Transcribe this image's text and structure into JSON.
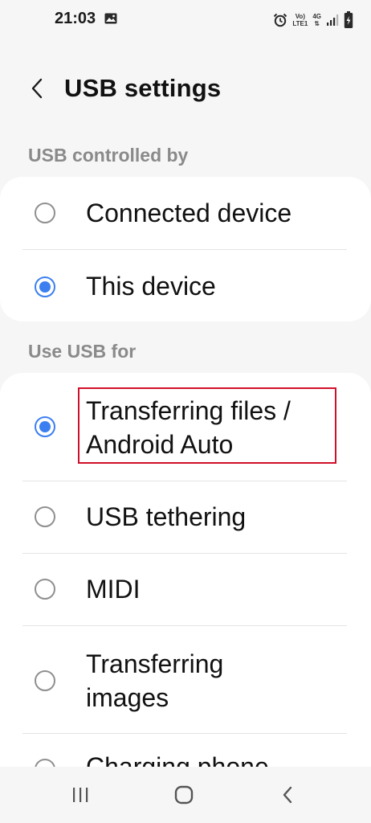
{
  "status_bar": {
    "time": "21:03",
    "network_top": "Vo)",
    "network_bottom": "LTE1",
    "signal_type": "4G",
    "icons": [
      "gallery-icon",
      "alarm-icon",
      "signal-icon",
      "battery-icon"
    ]
  },
  "header": {
    "back_icon": "chevron-left-icon",
    "title": "USB settings"
  },
  "usb_controlled_by": {
    "section_label": "USB controlled by",
    "options": [
      {
        "label": "Connected device",
        "selected": false
      },
      {
        "label": "This device",
        "selected": true
      }
    ]
  },
  "use_usb_for": {
    "section_label": "Use USB for",
    "options": [
      {
        "line1": "Transferring files /",
        "line2": "Android Auto",
        "selected": true
      },
      {
        "label": "USB tethering",
        "selected": false
      },
      {
        "label": "MIDI",
        "selected": false
      },
      {
        "line1": "Transferring",
        "line2": "images",
        "selected": false
      },
      {
        "label": "Charging phone",
        "selected": false
      }
    ]
  },
  "nav_bar": {
    "icons": [
      "recents-icon",
      "home-icon",
      "back-nav-icon"
    ]
  },
  "colors": {
    "accent": "#3b7ff0",
    "highlight": "#d0102a",
    "background": "#f6f6f6",
    "card": "#ffffff",
    "section_text": "#8a8a8a"
  }
}
